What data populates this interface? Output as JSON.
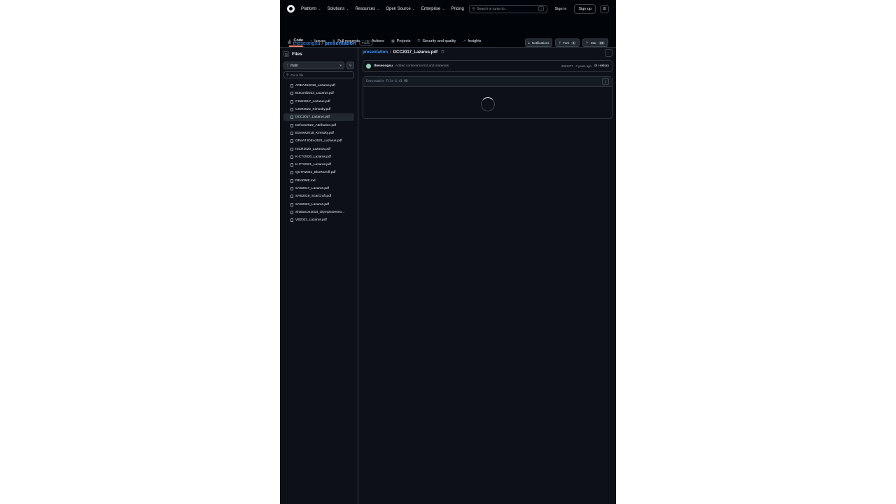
{
  "header": {
    "nav": [
      {
        "label": "Platform",
        "chevron": true
      },
      {
        "label": "Solutions",
        "chevron": true
      },
      {
        "label": "Resources",
        "chevron": true
      },
      {
        "label": "Open Source",
        "chevron": true
      },
      {
        "label": "Enterprise",
        "chevron": true
      },
      {
        "label": "Pricing",
        "chevron": false
      }
    ],
    "search_placeholder": "Search or jump to...",
    "search_key": "/",
    "sign_in": "Sign in",
    "sign_up": "Sign up"
  },
  "repo": {
    "owner": "theseongsu",
    "sep": "/",
    "name": "presentation",
    "visibility": "Public",
    "notifications": "Notifications",
    "fork": "Fork",
    "fork_count": "1",
    "star": "Star",
    "star_count": "26",
    "tabs": [
      "Code",
      "Issues",
      "Pull requests",
      "Actions",
      "Projects",
      "Security and quality",
      "Insights"
    ]
  },
  "sidebar": {
    "title": "Files",
    "branch": "main",
    "go_to_file": "Go to file",
    "files": [
      "AREA412018_Lazarus.pdf",
      "Botconf2023_Lazarus.pdf",
      "CSW2017_Lazarus.pdf",
      "CSW2022_Kimsuky.pdf",
      "DCC2017_Lazarus.pdf",
      "Defcon2022_Attribution.pdf",
      "Etnews2018_Kimsuky.pdf",
      "GReAT IDEA2021_Lazarus.pdf",
      "ISCR2020_Lazarus.pdf",
      "K-CTI2020_Lazarus.pdf",
      "K-CTI2021_Lazarus.pdf",
      "QCTR2021_BlueNoroff.pdf",
      "README.md",
      "SAS2017_Lazarus.pdf",
      "SAS2019_ScarCruft.pdf",
      "SAS2023_Lazarus.pdf",
      "Shakacon2018_OlympicDestro...",
      "VB2021_Lazarus.pdf"
    ],
    "active_index": 4
  },
  "content": {
    "breadcrumb_repo": "presentation",
    "breadcrumb_sep": "/",
    "breadcrumb_file": "DCC2017_Lazarus.pdf",
    "commit": {
      "author": "theseongsu",
      "message": "Added conference list and materials",
      "hash": "28d1377",
      "dot": "·",
      "time": "3 years ago",
      "history": "History"
    },
    "file_info": "Executable File  6.41 MB"
  },
  "colors": {
    "background": "#0d1117",
    "header": "#010409",
    "accent": "#4493f8",
    "active_tab": "#f78166"
  }
}
